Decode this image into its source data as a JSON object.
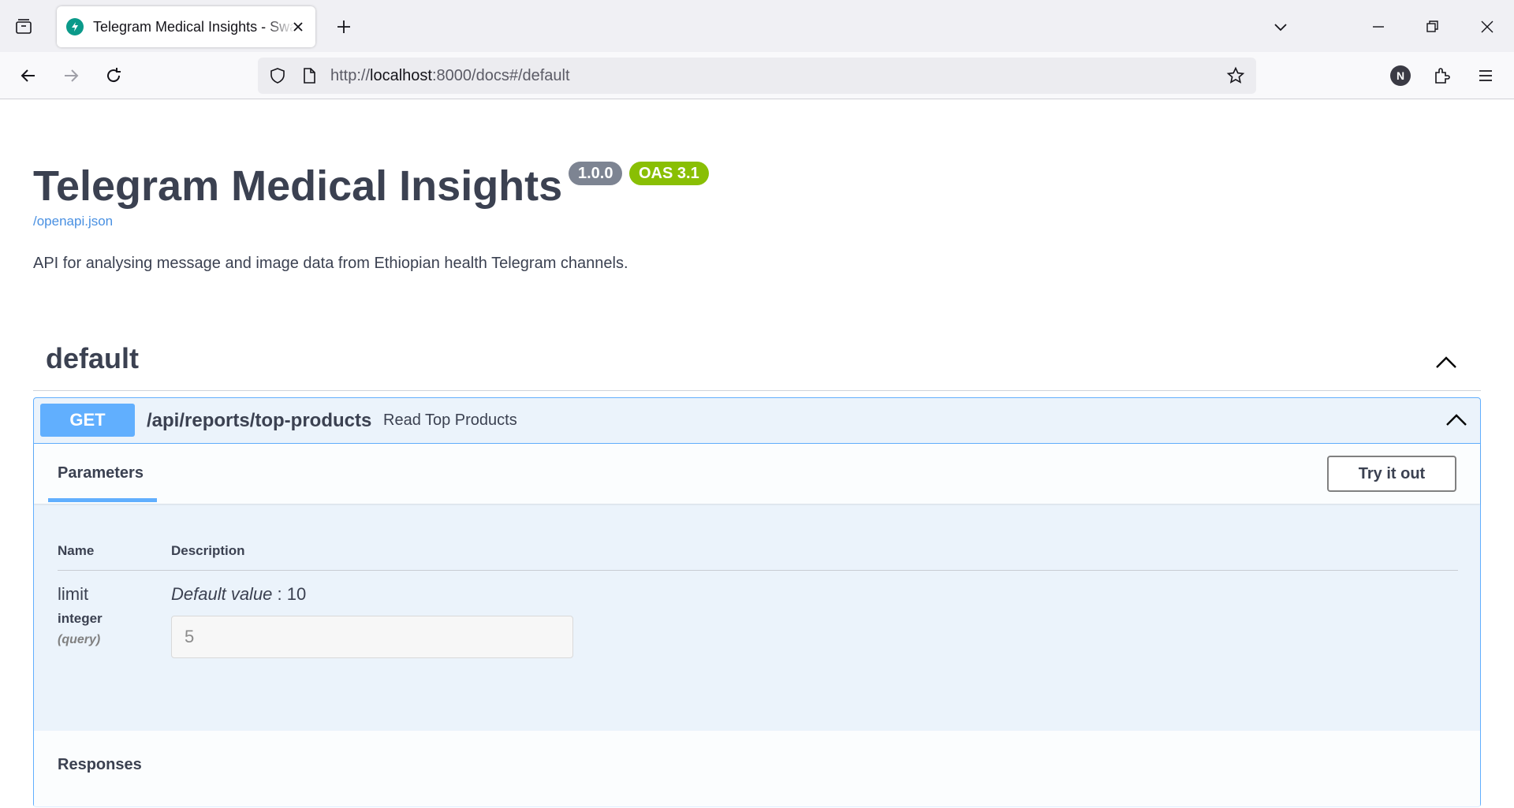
{
  "browser": {
    "tab_title": "Telegram Medical Insights - Swagger UI",
    "url_prefix": "http://",
    "url_host": "localhost",
    "url_rest": ":8000/docs#/default",
    "profile_initial": "N"
  },
  "info": {
    "title": "Telegram Medical Insights",
    "version": "1.0.0",
    "oas": "OAS 3.1",
    "spec_link": "/openapi.json",
    "description": "API for analysing message and image data from Ethiopian health Telegram channels."
  },
  "tag": {
    "name": "default"
  },
  "operation": {
    "method": "GET",
    "path": "/api/reports/top-products",
    "summary": "Read Top Products",
    "parameters_tab": "Parameters",
    "try_button": "Try it out",
    "columns": {
      "name": "Name",
      "description": "Description"
    },
    "parameter": {
      "name": "limit",
      "type": "integer",
      "in": "(query)",
      "default_label": "Default value",
      "default_sep": " : ",
      "default_value": "10",
      "input_value": "5"
    },
    "responses_title": "Responses"
  },
  "colors": {
    "get_accent": "#61affe",
    "opblock_bg": "#ebf3fb",
    "oas_badge": "#89bf04",
    "version_badge": "#7d8492"
  }
}
